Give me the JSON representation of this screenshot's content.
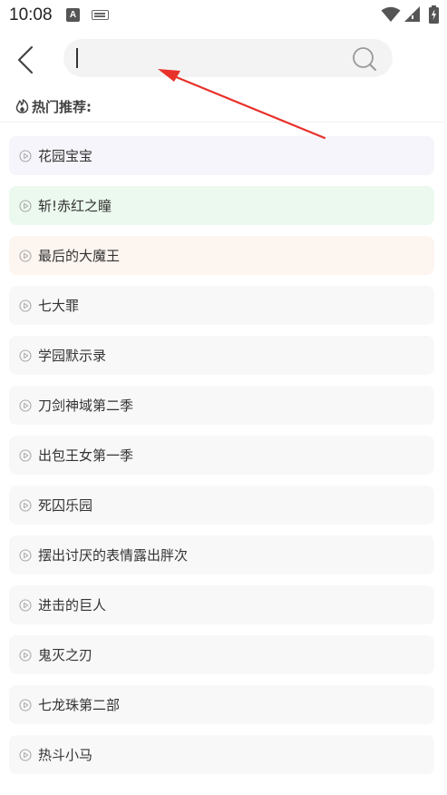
{
  "status": {
    "time": "10:08",
    "indicator_letter": "A"
  },
  "search": {
    "placeholder": "",
    "value": ""
  },
  "hot": {
    "title": "热门推荐:"
  },
  "items": [
    {
      "label": "花园宝宝",
      "bg": "#f5f5fb"
    },
    {
      "label": "斩!赤红之瞳",
      "bg": "#ecf9ee"
    },
    {
      "label": "最后的大魔王",
      "bg": "#fdf5f0"
    },
    {
      "label": "七大罪",
      "bg": "#f8f8f8"
    },
    {
      "label": "学园默示录",
      "bg": "#f8f8f8"
    },
    {
      "label": "刀剑神域第二季",
      "bg": "#f8f8f8"
    },
    {
      "label": "出包王女第一季",
      "bg": "#f8f8f8"
    },
    {
      "label": "死囚乐园",
      "bg": "#f8f8f8"
    },
    {
      "label": "摆出讨厌的表情露出胖次",
      "bg": "#f8f8f8"
    },
    {
      "label": "进击的巨人",
      "bg": "#f8f8f8"
    },
    {
      "label": "鬼灭之刃",
      "bg": "#f8f8f8"
    },
    {
      "label": "七龙珠第二部",
      "bg": "#f8f8f8"
    },
    {
      "label": "热斗小马",
      "bg": "#f8f8f8"
    }
  ],
  "colors": {
    "annotation_arrow": "#e8312a"
  }
}
